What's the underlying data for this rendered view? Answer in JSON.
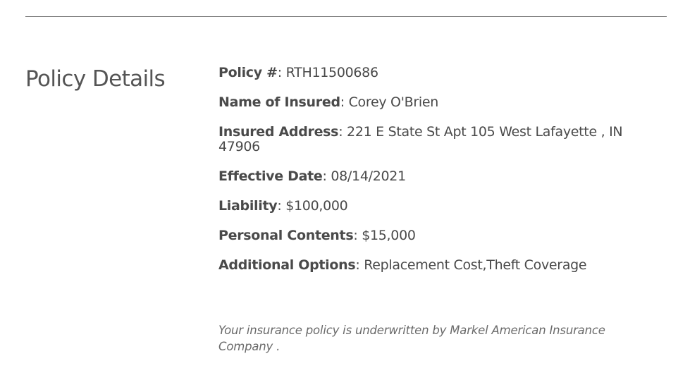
{
  "section": {
    "title": "Policy Details"
  },
  "details": [
    {
      "label": "Policy #",
      "value": "RTH11500686"
    },
    {
      "label": "Name of Insured",
      "value": "Corey O'Brien"
    },
    {
      "label": "Insured Address",
      "value": "221 E State St Apt 105 West Lafayette , IN 47906"
    },
    {
      "label": "Effective Date",
      "value": "08/14/2021"
    },
    {
      "label": "Liability",
      "value": "$100,000"
    },
    {
      "label": "Personal Contents",
      "value": "$15,000"
    },
    {
      "label": "Additional Options",
      "value": "Replacement Cost,Theft Coverage"
    }
  ],
  "separator": ": ",
  "footnote": "Your insurance policy is underwritten by Markel American Insurance Company ."
}
